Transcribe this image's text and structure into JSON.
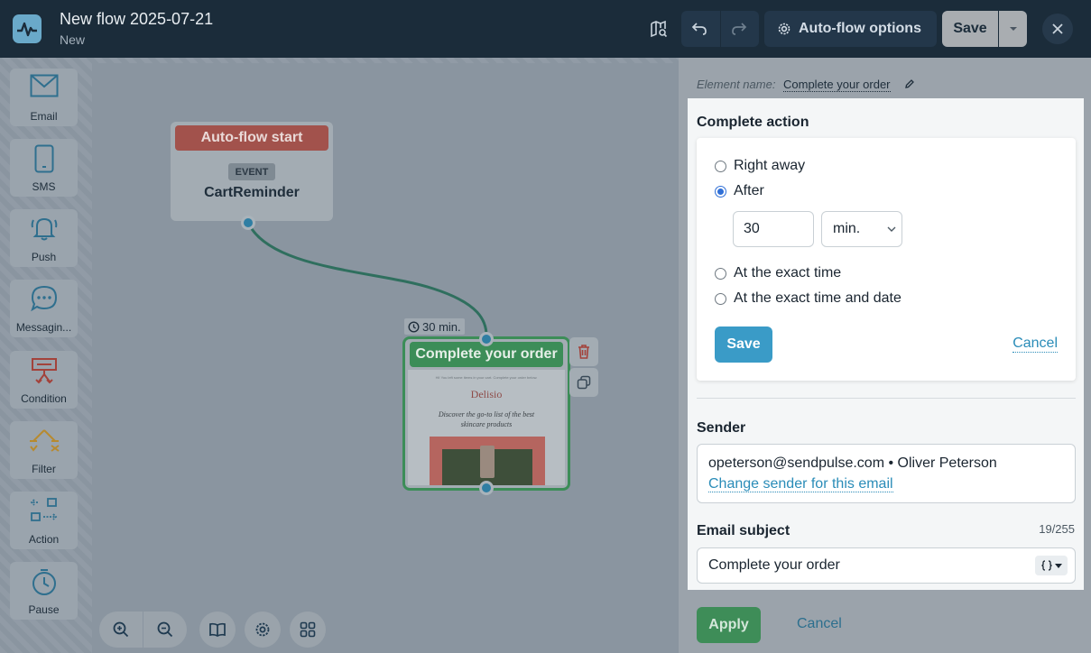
{
  "header": {
    "title": "New flow 2025-07-21",
    "status": "New",
    "auto_flow_options_label": "Auto-flow options",
    "save_label": "Save"
  },
  "sidebar": {
    "items": [
      {
        "label": "Email",
        "icon": "envelope-icon"
      },
      {
        "label": "SMS",
        "icon": "phone-icon"
      },
      {
        "label": "Push",
        "icon": "bell-icon"
      },
      {
        "label": "Messagin...",
        "icon": "chat-bubble-icon"
      },
      {
        "label": "Condition",
        "icon": "condition-icon"
      },
      {
        "label": "Filter",
        "icon": "filter-icon"
      },
      {
        "label": "Action",
        "icon": "action-icon"
      },
      {
        "label": "Pause",
        "icon": "stopwatch-icon"
      }
    ]
  },
  "canvas": {
    "start_node": {
      "header": "Auto-flow start",
      "badge": "EVENT",
      "event_name": "CartReminder"
    },
    "delay_label": "30 min.",
    "email_node": {
      "header": "Complete your order",
      "preview_tiny": "Hi! You left some items in your cart. Complete your order below.",
      "preview_brand": "Delisio",
      "preview_text": "Discover the go-to list of the best skincare products"
    }
  },
  "panel": {
    "element_name_label": "Element name:",
    "element_name_value": "Complete your order",
    "complete_action": {
      "title": "Complete action",
      "options": [
        "Right away",
        "After",
        "At the exact time",
        "At the exact time and date"
      ],
      "selected": "After",
      "delay_value": "30",
      "delay_unit": "min.",
      "save_label": "Save",
      "cancel_label": "Cancel"
    },
    "sender": {
      "label": "Sender",
      "value": "opeterson@sendpulse.com • Oliver Peterson",
      "change_link": "Change sender for this email"
    },
    "subject": {
      "label": "Email subject",
      "counter": "19/255",
      "value": "Complete your order"
    },
    "apply_label": "Apply",
    "cancel_label": "Cancel"
  },
  "colors": {
    "topbar": "#1b2c3a",
    "start_header": "#a2524c",
    "email_header": "#3c8d58",
    "link": "#2a8cb8",
    "save_blue": "#3a9bc7",
    "apply_green": "#3e8d58"
  }
}
